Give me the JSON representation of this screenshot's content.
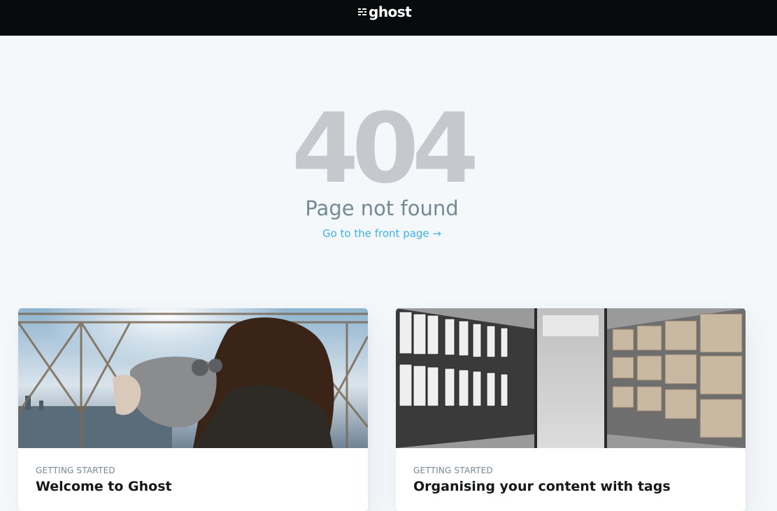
{
  "header": {
    "logo_text": "ghost",
    "logo_icon": "ghost-logo-icon"
  },
  "error": {
    "code": "404",
    "description": "Page not found",
    "link_label": "Go to the front page →"
  },
  "cards": [
    {
      "tag": "GETTING STARTED",
      "title": "Welcome to Ghost",
      "image": "woman-at-observation-binoculars-photo"
    },
    {
      "tag": "GETTING STARTED",
      "title": "Organising your content with tags",
      "image": "archive-shelves-with-boxes-photo"
    }
  ],
  "colors": {
    "header_bg": "#090a0b",
    "page_bg": "#f4f8fb",
    "error_code": "#c5c9cd",
    "error_desc": "#738a94",
    "link": "#3eb0ef",
    "tag": "#738a94",
    "title": "#15171a"
  }
}
